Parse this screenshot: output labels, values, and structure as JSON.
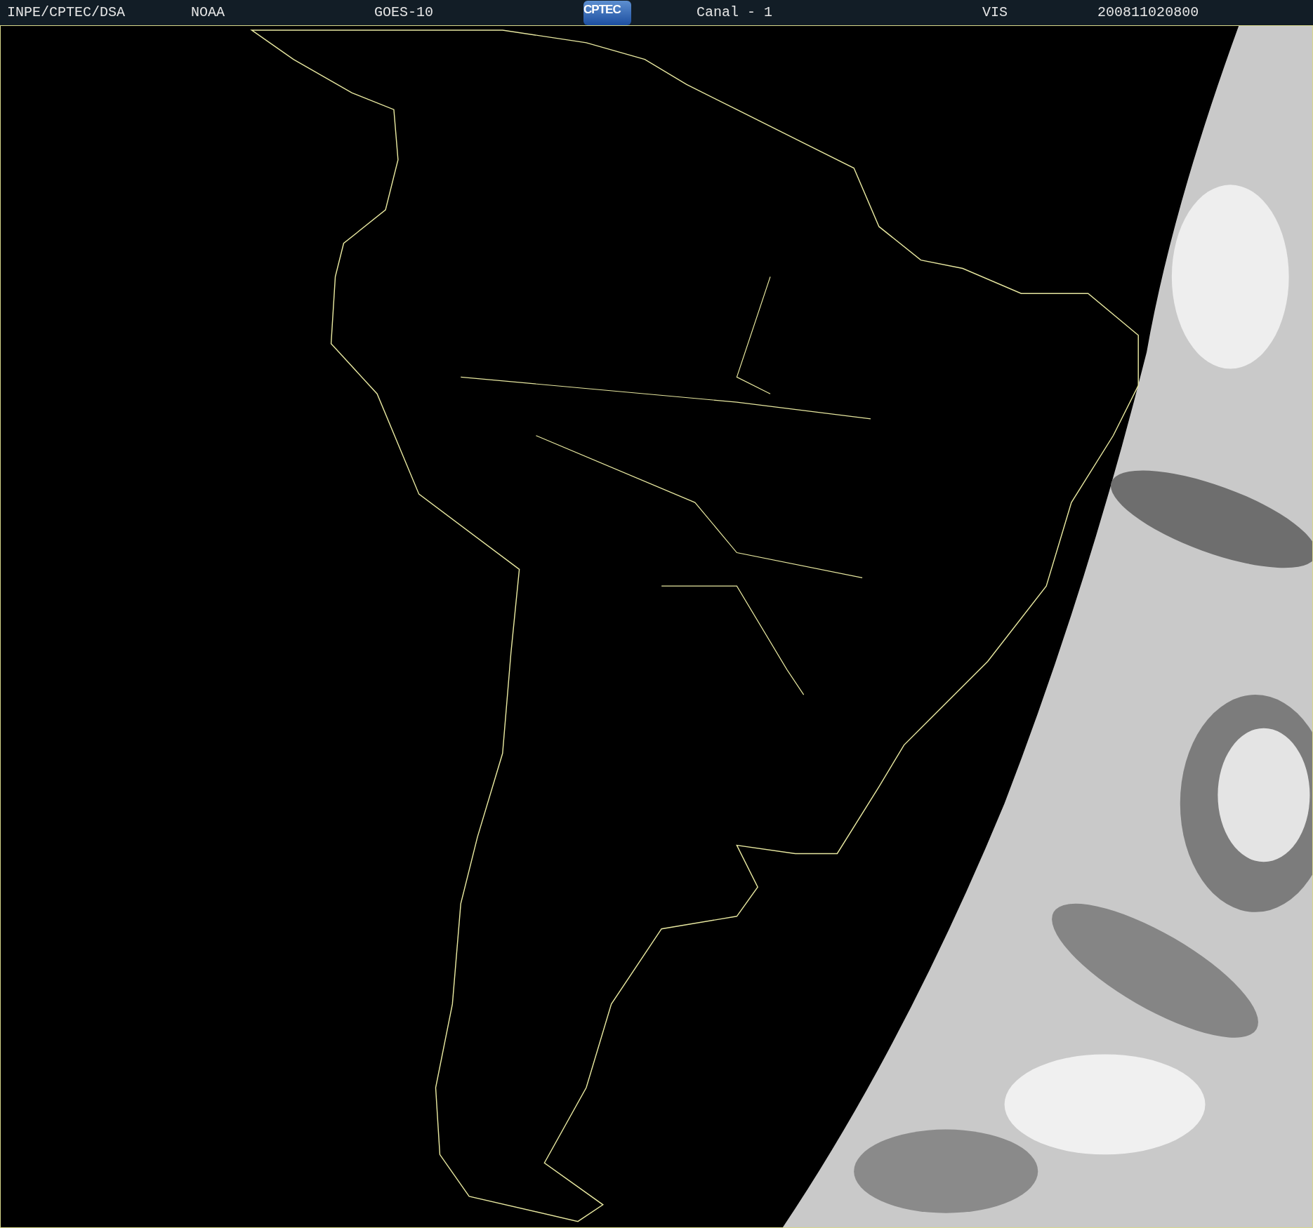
{
  "header": {
    "source": "INPE/CPTEC/DSA",
    "agency": "NOAA",
    "satellite": "GOES-10",
    "logo": "CPTEC",
    "channel": "Canal - 1",
    "band": "VIS",
    "timestamp": "200811020800"
  }
}
